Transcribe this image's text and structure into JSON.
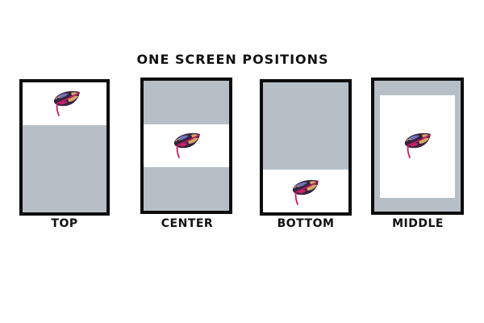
{
  "title": "ONE SCREEN POSITIONS",
  "colors": {
    "frame": "#0d0d0d",
    "screen_gray": "#b6bfc6",
    "content_white": "#ffffff",
    "leaf_dark": "#35233d",
    "leaf_gold": "#d3a86a",
    "leaf_blue": "#6f73b8",
    "leaf_pink": "#cc1f6a",
    "leaf_stem": "#c21d63"
  },
  "panels": [
    {
      "caption": "TOP"
    },
    {
      "caption": "CENTER"
    },
    {
      "caption": "BOTTOM"
    },
    {
      "caption": "MIDDLE"
    }
  ],
  "icon": "monstera-leaf-icon"
}
